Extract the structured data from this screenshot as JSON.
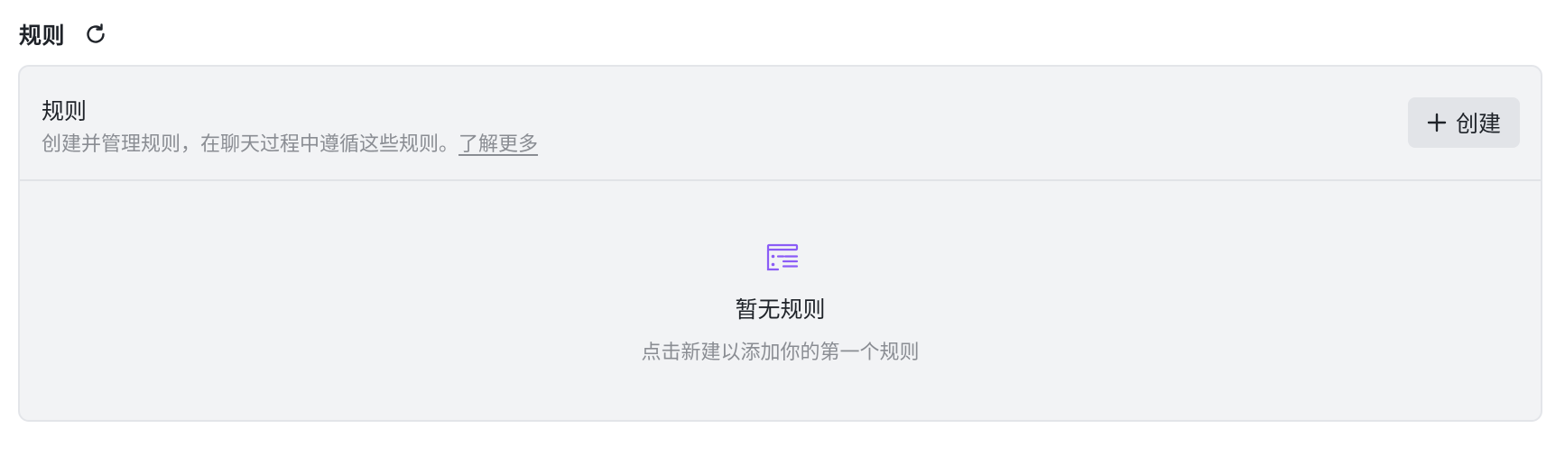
{
  "header": {
    "title": "规则",
    "refresh_icon": "refresh-icon"
  },
  "card": {
    "title": "规则",
    "description": "创建并管理规则，在聊天过程中遵循这些规则。",
    "learn_more": "了解更多",
    "create_button": {
      "icon": "plus-icon",
      "label": "创建"
    }
  },
  "empty_state": {
    "icon": "rules-list-icon",
    "title": "暂无规则",
    "subtitle": "点击新建以添加你的第一个规则"
  },
  "colors": {
    "accent": "#8b5cf6",
    "card_background": "#f2f3f5",
    "muted_text": "#8a8d93"
  }
}
